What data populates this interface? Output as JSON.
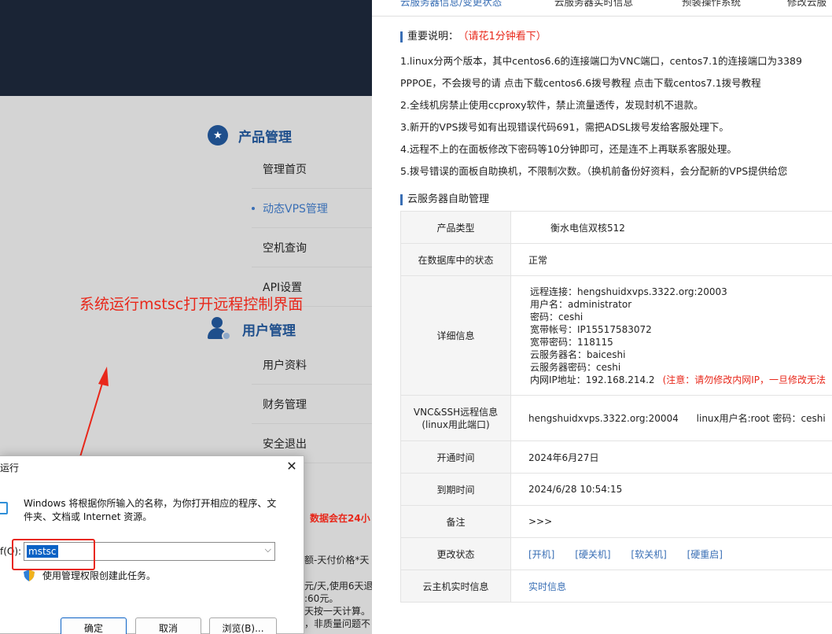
{
  "left": {
    "product_title": "产品管理",
    "product_items": [
      "管理首页",
      "动态VPS管理",
      "空机查询",
      "API设置"
    ],
    "user_title": "用户管理",
    "user_items": [
      "用户资料",
      "财务管理",
      "安全退出"
    ],
    "annotation": "系统运行mstsc打开远程控制界面",
    "snippets": [
      "数据会在24小",
      "额-天付价格*天",
      "元/天,使用6天退",
      ":60元。",
      "天按一天计算。",
      "，非质量问题不"
    ]
  },
  "tabs": [
    "云服务器信息/变更状态",
    "云服务器实时信息",
    "预装操作系统",
    "修改云服"
  ],
  "notice": {
    "title": "重要说明：",
    "title_note": "（请花1分钟看下）",
    "lines": [
      "1.linux分两个版本，其中centos6.6的连接端口为VNC端口，centos7.1的连接端口为3389",
      "PPPOE，不会拨号的请 点击下载centos6.6拨号教程 点击下载centos7.1拨号教程",
      "2.全线机房禁止使用ccproxy软件，禁止流量透传，发现封机不退款。",
      "3.新开的VPS拨号如有出现错误代码691，需把ADSL拨号发给客服处理下。",
      "4.远程不上的在面板修改下密码等10分钟即可，还是连不上再联系客服处理。",
      "5.拨号错误的面板自助换机，不限制次数。（换机前备份好资料，会分配新的VPS提供给您"
    ]
  },
  "manage": {
    "title": "云服务器自助管理",
    "rows": {
      "product_type": {
        "label": "产品类型",
        "value": "衡水电信双核512"
      },
      "db_status": {
        "label": "在数据库中的状态",
        "value": "正常"
      },
      "details_label": "详细信息",
      "details": [
        "远程连接：hengshuidxvps.3322.org:20003",
        "用户名：administrator",
        "密码：ceshi",
        "宽带帐号：IP15517583072",
        "宽带密码：118115",
        "云服务器名：baiceshi",
        "云服务器密码：ceshi",
        "内网IP地址：192.168.214.2"
      ],
      "details_warning": "(注意：请勿修改内网IP，一旦修改无法",
      "vnc": {
        "label_line1": "VNC&SSH远程信息",
        "label_line2": "(linux用此端口)",
        "value": "hengshuidxvps.3322.org:20004      linux用户名:root 密码：ceshi"
      },
      "open_time": {
        "label": "开通时间",
        "value": "2024年6月27日"
      },
      "expire_time": {
        "label": "到期时间",
        "value": "2024/6/28 10:54:15"
      },
      "remark": {
        "label": "备注",
        "value": ">>>"
      },
      "change_status": {
        "label": "更改状态",
        "links": [
          "[开机]",
          "[硬关机]",
          "[软关机]",
          "[硬重启]"
        ]
      },
      "realtime": {
        "label": "云主机实时信息",
        "link": "实时信息"
      }
    }
  },
  "run_dialog": {
    "title": "运行",
    "description": "Windows 将根据你所输入的名称，为你打开相应的程序、文件夹、文档或 Internet 资源。",
    "open_label": "f(O):",
    "input_value": "mstsc",
    "admin_text": "使用管理权限创建此任务。",
    "ok": "确定",
    "cancel": "取消",
    "browse": "浏览(B)..."
  },
  "colors": {
    "accent": "#3a6fb5",
    "annotation_red": "#e8271a",
    "banner": "#1a2435",
    "selection": "#0b62c5"
  }
}
